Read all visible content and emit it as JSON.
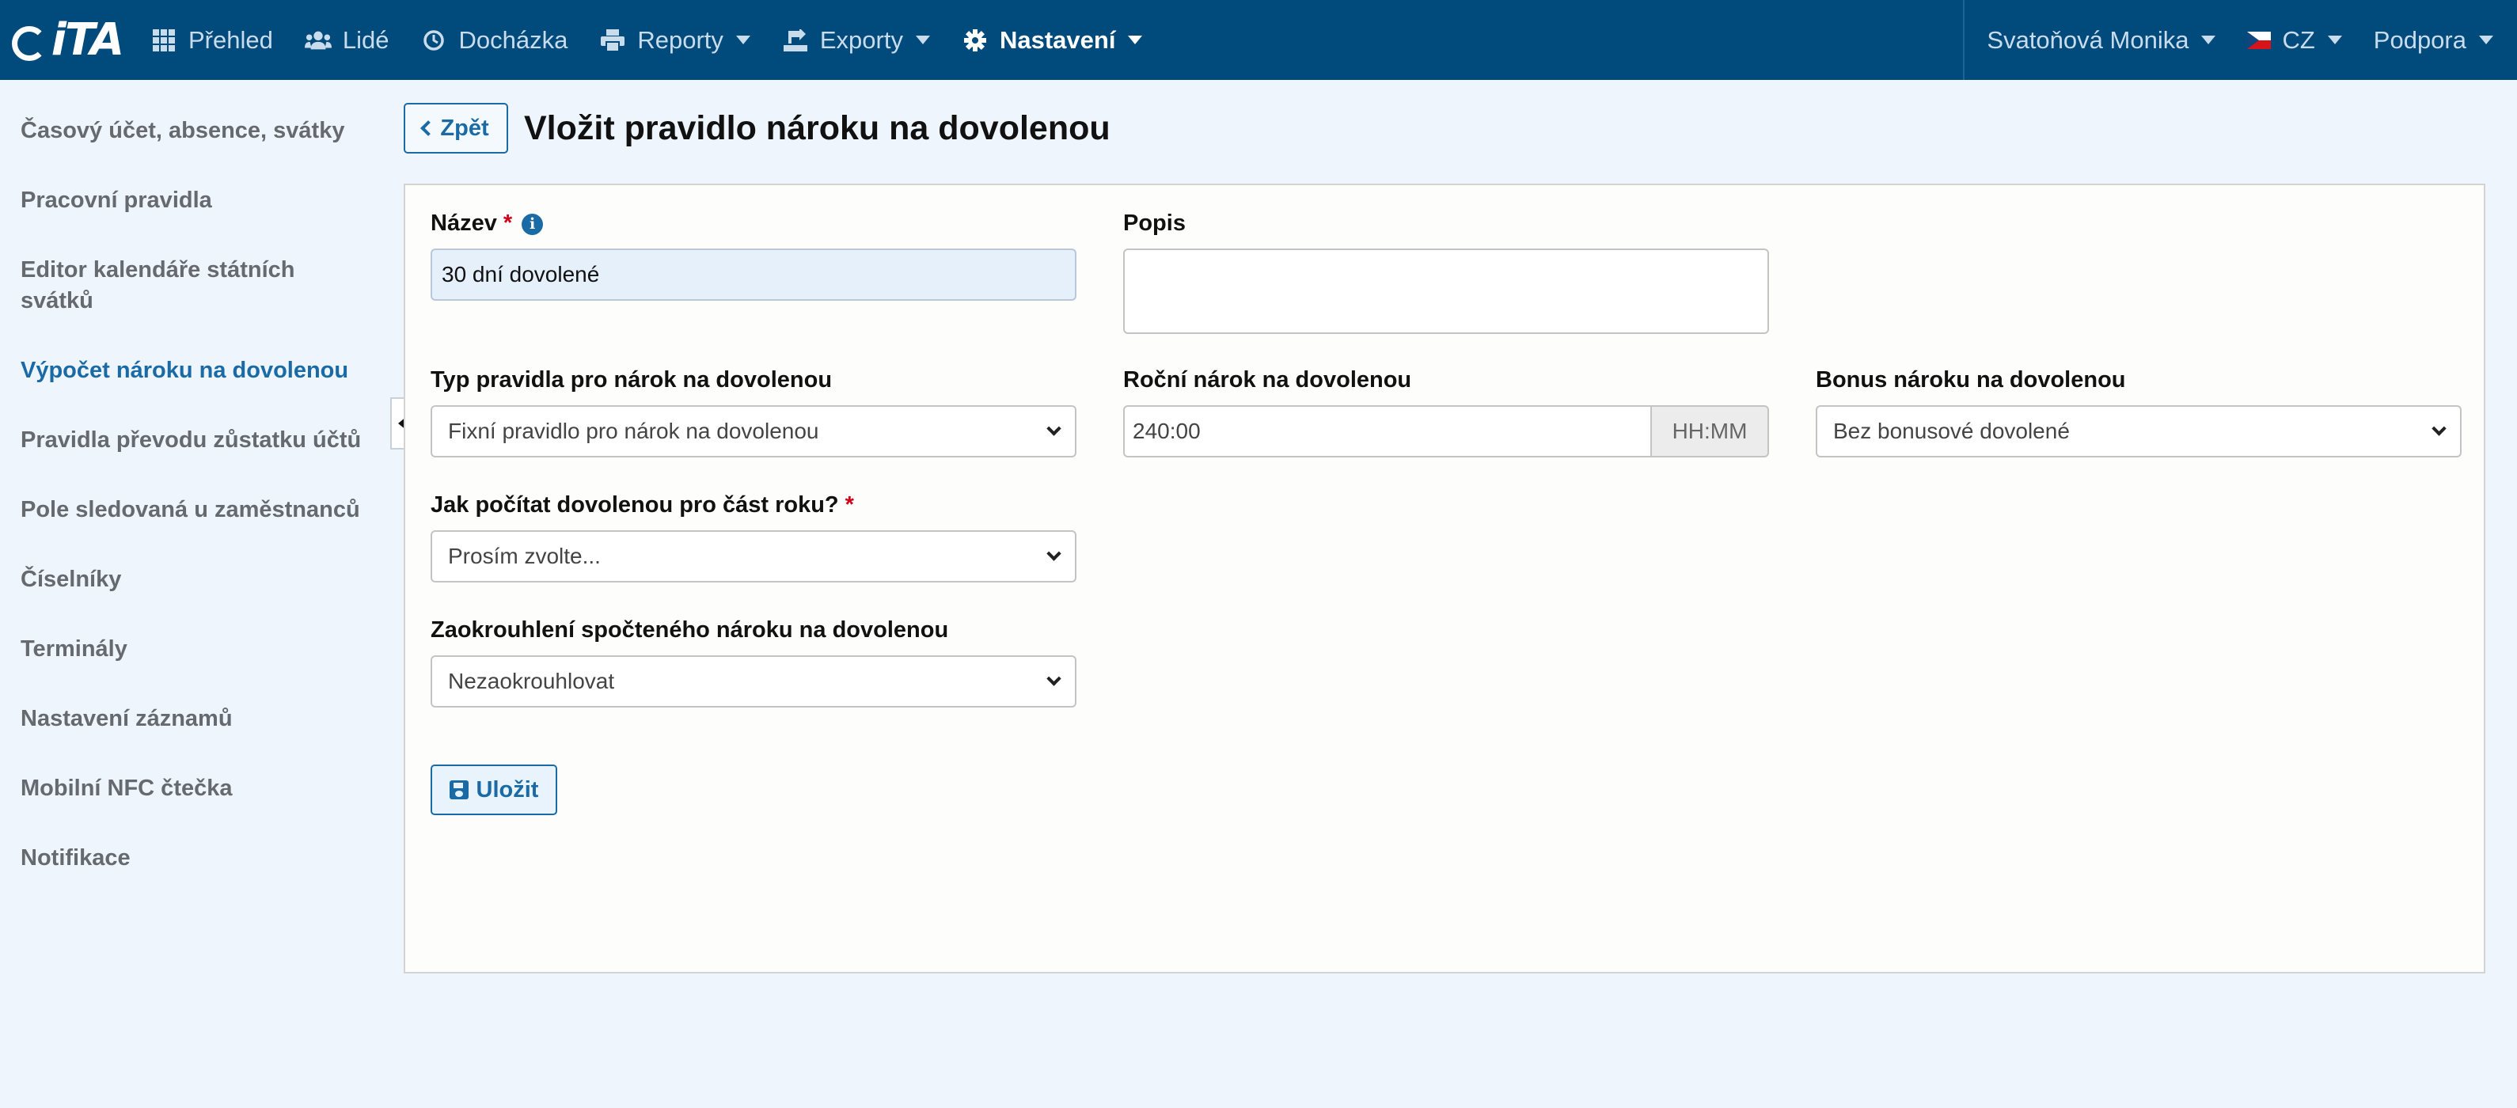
{
  "navbar": {
    "logo": "iTA",
    "items": [
      {
        "label": "Přehled",
        "icon": "grid-icon"
      },
      {
        "label": "Lidé",
        "icon": "users-icon"
      },
      {
        "label": "Docházka",
        "icon": "clock-icon"
      },
      {
        "label": "Reporty",
        "icon": "printer-icon"
      },
      {
        "label": "Exporty",
        "icon": "export-icon"
      },
      {
        "label": "Nastavení",
        "icon": "gear-icon"
      }
    ],
    "user": "Svatoňová Monika",
    "language": "CZ",
    "support": "Podpora"
  },
  "sidebar": {
    "items": [
      {
        "label": "Časový účet, absence, svátky"
      },
      {
        "label": "Pracovní pravidla"
      },
      {
        "label": "Editor kalendáře státních svátků"
      },
      {
        "label": "Výpočet nároku na dovolenou"
      },
      {
        "label": "Pravidla převodu zůstatku účtů"
      },
      {
        "label": "Pole sledovaná u zaměstnanců"
      },
      {
        "label": "Číselníky"
      },
      {
        "label": "Terminály"
      },
      {
        "label": "Nastavení záznamů"
      },
      {
        "label": "Mobilní NFC čtečka"
      },
      {
        "label": "Notifikace"
      }
    ],
    "active_index": 3
  },
  "header": {
    "back_label": "Zpět",
    "title": "Vložit pravidlo nároku na dovolenou"
  },
  "form": {
    "name": {
      "label": "Název",
      "required_mark": "*",
      "value": "30 dní dovolené"
    },
    "description": {
      "label": "Popis",
      "value": ""
    },
    "rule_type": {
      "label": "Typ pravidla pro nárok na dovolenou",
      "selected": "Fixní pravidlo pro nárok na dovolenou"
    },
    "annual": {
      "label": "Roční nárok na dovolenou",
      "value": "240:00",
      "unit": "HH:MM"
    },
    "bonus": {
      "label": "Bonus nároku na dovolenou",
      "selected": "Bez bonusové dovolené"
    },
    "partial_year": {
      "label": "Jak počítat dovolenou pro část roku?",
      "required_mark": "*",
      "selected": "Prosím zvolte..."
    },
    "rounding": {
      "label": "Zaokrouhlení spočteného nároku na dovolenou",
      "selected": "Nezaokrouhlovat"
    },
    "save_label": "Uložit"
  },
  "colors": {
    "navbar": "#004a7c",
    "accent": "#1a6aa6",
    "required": "#d0021b",
    "page_bg": "#eef5fc"
  }
}
